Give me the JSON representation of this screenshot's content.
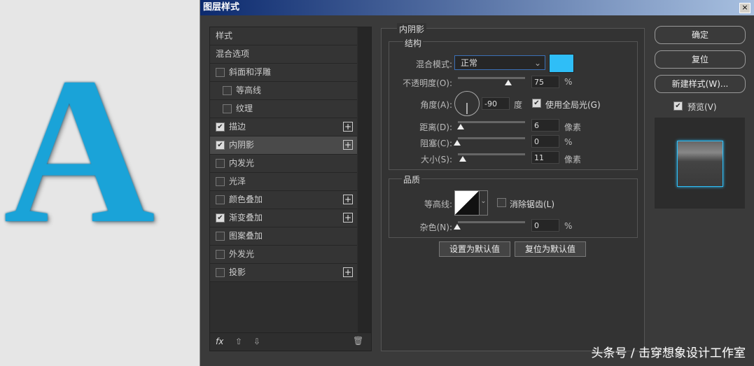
{
  "canvas": {
    "letter": "A"
  },
  "dialog": {
    "title": "图层样式",
    "close": "×"
  },
  "list": {
    "items": [
      {
        "label": "样式",
        "checkbox": false,
        "checked": false,
        "plus": false,
        "indent": 0
      },
      {
        "label": "混合选项",
        "checkbox": false,
        "checked": false,
        "plus": false,
        "indent": 0
      },
      {
        "label": "斜面和浮雕",
        "checkbox": true,
        "checked": false,
        "plus": false,
        "indent": 0
      },
      {
        "label": "等高线",
        "checkbox": true,
        "checked": false,
        "plus": false,
        "indent": 1
      },
      {
        "label": "纹理",
        "checkbox": true,
        "checked": false,
        "plus": false,
        "indent": 1
      },
      {
        "label": "描边",
        "checkbox": true,
        "checked": true,
        "plus": true,
        "indent": 0
      },
      {
        "label": "内阴影",
        "checkbox": true,
        "checked": true,
        "plus": true,
        "indent": 0,
        "selected": true
      },
      {
        "label": "内发光",
        "checkbox": true,
        "checked": false,
        "plus": false,
        "indent": 0
      },
      {
        "label": "光泽",
        "checkbox": true,
        "checked": false,
        "plus": false,
        "indent": 0
      },
      {
        "label": "颜色叠加",
        "checkbox": true,
        "checked": false,
        "plus": true,
        "indent": 0
      },
      {
        "label": "渐变叠加",
        "checkbox": true,
        "checked": true,
        "plus": true,
        "indent": 0
      },
      {
        "label": "图案叠加",
        "checkbox": true,
        "checked": false,
        "plus": false,
        "indent": 0
      },
      {
        "label": "外发光",
        "checkbox": true,
        "checked": false,
        "plus": false,
        "indent": 0
      },
      {
        "label": "投影",
        "checkbox": true,
        "checked": false,
        "plus": true,
        "indent": 0
      }
    ],
    "fx": "fx"
  },
  "panel": {
    "title": "内阴影",
    "structure": "结构",
    "blend_label": "混合模式:",
    "blend_value": "正常",
    "color": "#2fbef7",
    "opacity_label": "不透明度(O):",
    "opacity": "75",
    "opacity_unit": "%",
    "opacity_frac": 0.75,
    "angle_label": "角度(A):",
    "angle": "-90",
    "angle_unit": "度",
    "global_light": "使用全局光(G)",
    "distance_label": "距离(D):",
    "distance": "6",
    "distance_unit": "像素",
    "choke_label": "阻塞(C):",
    "choke": "0",
    "choke_unit": "%",
    "size_label": "大小(S):",
    "size": "11",
    "size_unit": "像素",
    "quality": "品质",
    "contour_label": "等高线:",
    "antialias": "消除锯齿(L)",
    "noise_label": "杂色(N):",
    "noise": "0",
    "noise_unit": "%",
    "set_default": "设置为默认值",
    "reset_default": "复位为默认值"
  },
  "buttons": {
    "ok": "确定",
    "reset": "复位",
    "new_style": "新建样式(W)...",
    "preview": "预览(V)"
  },
  "watermark": "头条号 / 击穿想象设计工作室"
}
